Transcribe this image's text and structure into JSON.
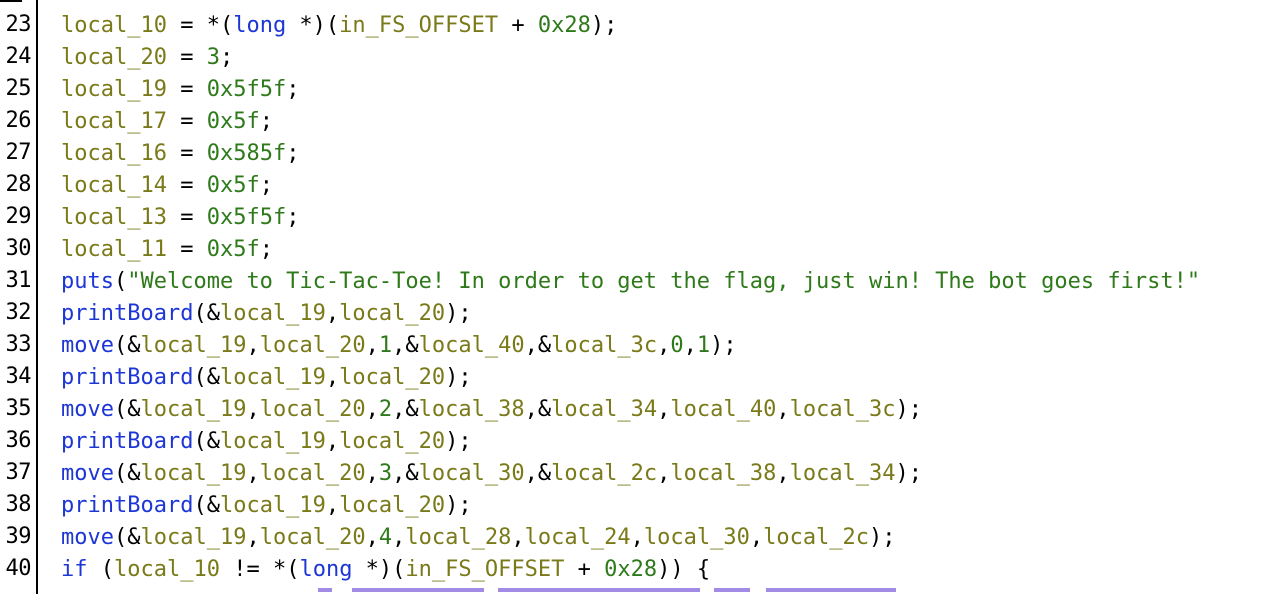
{
  "colors": {
    "variable": "#7a7a1a",
    "function": "#1d36d6",
    "number": "#2e7a1a",
    "string": "#2e7a1a",
    "keyword": "#1d36d6",
    "operator": "#000000",
    "gutter_text": "#000000",
    "comment_purple": "#7a5ad8"
  },
  "lines": [
    {
      "number": "23",
      "tokens": [
        {
          "t": "local_10",
          "c": "var"
        },
        {
          "t": " = *(",
          "c": "op"
        },
        {
          "t": "long",
          "c": "kw"
        },
        {
          "t": " *)(",
          "c": "op"
        },
        {
          "t": "in_FS_OFFSET",
          "c": "var"
        },
        {
          "t": " + ",
          "c": "op"
        },
        {
          "t": "0x28",
          "c": "num"
        },
        {
          "t": ");",
          "c": "op"
        }
      ]
    },
    {
      "number": "24",
      "tokens": [
        {
          "t": "local_20",
          "c": "var"
        },
        {
          "t": " = ",
          "c": "op"
        },
        {
          "t": "3",
          "c": "num"
        },
        {
          "t": ";",
          "c": "op"
        }
      ]
    },
    {
      "number": "25",
      "tokens": [
        {
          "t": "local_19",
          "c": "var"
        },
        {
          "t": " = ",
          "c": "op"
        },
        {
          "t": "0x5f5f",
          "c": "num"
        },
        {
          "t": ";",
          "c": "op"
        }
      ]
    },
    {
      "number": "26",
      "tokens": [
        {
          "t": "local_17",
          "c": "var"
        },
        {
          "t": " = ",
          "c": "op"
        },
        {
          "t": "0x5f",
          "c": "num"
        },
        {
          "t": ";",
          "c": "op"
        }
      ]
    },
    {
      "number": "27",
      "tokens": [
        {
          "t": "local_16",
          "c": "var"
        },
        {
          "t": " = ",
          "c": "op"
        },
        {
          "t": "0x585f",
          "c": "num"
        },
        {
          "t": ";",
          "c": "op"
        }
      ]
    },
    {
      "number": "28",
      "tokens": [
        {
          "t": "local_14",
          "c": "var"
        },
        {
          "t": " = ",
          "c": "op"
        },
        {
          "t": "0x5f",
          "c": "num"
        },
        {
          "t": ";",
          "c": "op"
        }
      ]
    },
    {
      "number": "29",
      "tokens": [
        {
          "t": "local_13",
          "c": "var"
        },
        {
          "t": " = ",
          "c": "op"
        },
        {
          "t": "0x5f5f",
          "c": "num"
        },
        {
          "t": ";",
          "c": "op"
        }
      ]
    },
    {
      "number": "30",
      "tokens": [
        {
          "t": "local_11",
          "c": "var"
        },
        {
          "t": " = ",
          "c": "op"
        },
        {
          "t": "0x5f",
          "c": "num"
        },
        {
          "t": ";",
          "c": "op"
        }
      ]
    },
    {
      "number": "31",
      "tokens": [
        {
          "t": "puts",
          "c": "fn"
        },
        {
          "t": "(",
          "c": "op"
        },
        {
          "t": "\"Welcome to Tic-Tac-Toe! In order to get the flag, just win! The bot goes first!\"",
          "c": "str"
        }
      ]
    },
    {
      "number": "32",
      "tokens": [
        {
          "t": "printBoard",
          "c": "fn"
        },
        {
          "t": "(&",
          "c": "op"
        },
        {
          "t": "local_19",
          "c": "var"
        },
        {
          "t": ",",
          "c": "op"
        },
        {
          "t": "local_20",
          "c": "var"
        },
        {
          "t": ");",
          "c": "op"
        }
      ]
    },
    {
      "number": "33",
      "tokens": [
        {
          "t": "move",
          "c": "fn"
        },
        {
          "t": "(&",
          "c": "op"
        },
        {
          "t": "local_19",
          "c": "var"
        },
        {
          "t": ",",
          "c": "op"
        },
        {
          "t": "local_20",
          "c": "var"
        },
        {
          "t": ",",
          "c": "op"
        },
        {
          "t": "1",
          "c": "num"
        },
        {
          "t": ",&",
          "c": "op"
        },
        {
          "t": "local_40",
          "c": "var"
        },
        {
          "t": ",&",
          "c": "op"
        },
        {
          "t": "local_3c",
          "c": "var"
        },
        {
          "t": ",",
          "c": "op"
        },
        {
          "t": "0",
          "c": "num"
        },
        {
          "t": ",",
          "c": "op"
        },
        {
          "t": "1",
          "c": "num"
        },
        {
          "t": ");",
          "c": "op"
        }
      ]
    },
    {
      "number": "34",
      "tokens": [
        {
          "t": "printBoard",
          "c": "fn"
        },
        {
          "t": "(&",
          "c": "op"
        },
        {
          "t": "local_19",
          "c": "var"
        },
        {
          "t": ",",
          "c": "op"
        },
        {
          "t": "local_20",
          "c": "var"
        },
        {
          "t": ");",
          "c": "op"
        }
      ]
    },
    {
      "number": "35",
      "tokens": [
        {
          "t": "move",
          "c": "fn"
        },
        {
          "t": "(&",
          "c": "op"
        },
        {
          "t": "local_19",
          "c": "var"
        },
        {
          "t": ",",
          "c": "op"
        },
        {
          "t": "local_20",
          "c": "var"
        },
        {
          "t": ",",
          "c": "op"
        },
        {
          "t": "2",
          "c": "num"
        },
        {
          "t": ",&",
          "c": "op"
        },
        {
          "t": "local_38",
          "c": "var"
        },
        {
          "t": ",&",
          "c": "op"
        },
        {
          "t": "local_34",
          "c": "var"
        },
        {
          "t": ",",
          "c": "op"
        },
        {
          "t": "local_40",
          "c": "var"
        },
        {
          "t": ",",
          "c": "op"
        },
        {
          "t": "local_3c",
          "c": "var"
        },
        {
          "t": ");",
          "c": "op"
        }
      ]
    },
    {
      "number": "36",
      "tokens": [
        {
          "t": "printBoard",
          "c": "fn"
        },
        {
          "t": "(&",
          "c": "op"
        },
        {
          "t": "local_19",
          "c": "var"
        },
        {
          "t": ",",
          "c": "op"
        },
        {
          "t": "local_20",
          "c": "var"
        },
        {
          "t": ");",
          "c": "op"
        }
      ]
    },
    {
      "number": "37",
      "tokens": [
        {
          "t": "move",
          "c": "fn"
        },
        {
          "t": "(&",
          "c": "op"
        },
        {
          "t": "local_19",
          "c": "var"
        },
        {
          "t": ",",
          "c": "op"
        },
        {
          "t": "local_20",
          "c": "var"
        },
        {
          "t": ",",
          "c": "op"
        },
        {
          "t": "3",
          "c": "num"
        },
        {
          "t": ",&",
          "c": "op"
        },
        {
          "t": "local_30",
          "c": "var"
        },
        {
          "t": ",&",
          "c": "op"
        },
        {
          "t": "local_2c",
          "c": "var"
        },
        {
          "t": ",",
          "c": "op"
        },
        {
          "t": "local_38",
          "c": "var"
        },
        {
          "t": ",",
          "c": "op"
        },
        {
          "t": "local_34",
          "c": "var"
        },
        {
          "t": ");",
          "c": "op"
        }
      ]
    },
    {
      "number": "38",
      "tokens": [
        {
          "t": "printBoard",
          "c": "fn"
        },
        {
          "t": "(&",
          "c": "op"
        },
        {
          "t": "local_19",
          "c": "var"
        },
        {
          "t": ",",
          "c": "op"
        },
        {
          "t": "local_20",
          "c": "var"
        },
        {
          "t": ");",
          "c": "op"
        }
      ]
    },
    {
      "number": "39",
      "tokens": [
        {
          "t": "move",
          "c": "fn"
        },
        {
          "t": "(&",
          "c": "op"
        },
        {
          "t": "local_19",
          "c": "var"
        },
        {
          "t": ",",
          "c": "op"
        },
        {
          "t": "local_20",
          "c": "var"
        },
        {
          "t": ",",
          "c": "op"
        },
        {
          "t": "4",
          "c": "num"
        },
        {
          "t": ",",
          "c": "op"
        },
        {
          "t": "local_28",
          "c": "var"
        },
        {
          "t": ",",
          "c": "op"
        },
        {
          "t": "local_24",
          "c": "var"
        },
        {
          "t": ",",
          "c": "op"
        },
        {
          "t": "local_30",
          "c": "var"
        },
        {
          "t": ",",
          "c": "op"
        },
        {
          "t": "local_2c",
          "c": "var"
        },
        {
          "t": ");",
          "c": "op"
        }
      ]
    },
    {
      "number": "40",
      "tokens": [
        {
          "t": "if",
          "c": "kw"
        },
        {
          "t": " (",
          "c": "op"
        },
        {
          "t": "local_10",
          "c": "var"
        },
        {
          "t": " != *(",
          "c": "op"
        },
        {
          "t": "long",
          "c": "kw"
        },
        {
          "t": " *)(",
          "c": "op"
        },
        {
          "t": "in_FS_OFFSET",
          "c": "var"
        },
        {
          "t": " + ",
          "c": "op"
        },
        {
          "t": "0x28",
          "c": "num"
        },
        {
          "t": ")) {",
          "c": "op"
        }
      ]
    }
  ]
}
